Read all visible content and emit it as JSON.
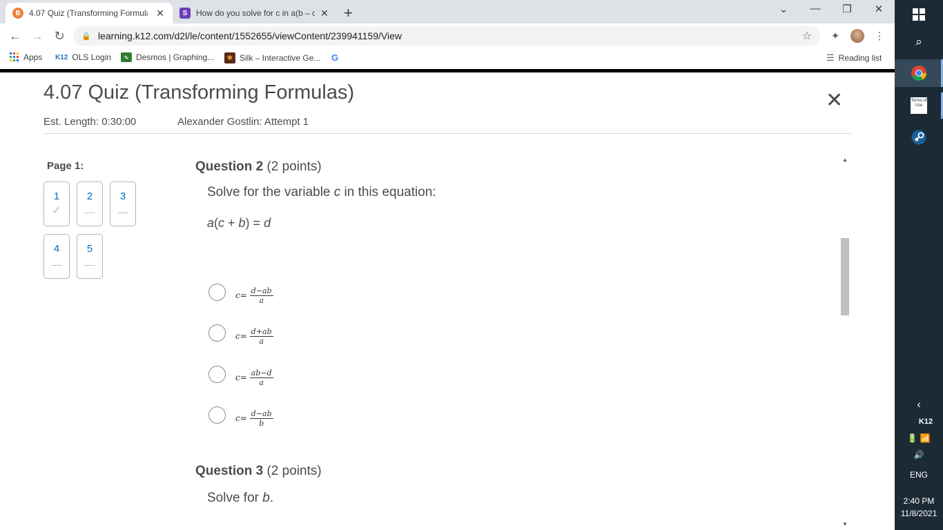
{
  "browser": {
    "tabs": [
      {
        "title": "4.07 Quiz (Transforming Formula",
        "favicon": "k12-icon",
        "close": "✕"
      },
      {
        "title": "How do you solve for c in a(b – c",
        "favicon": "silk-s-icon",
        "close": "✕"
      }
    ],
    "new_tab": "+",
    "url": "learning.k12.com/d2l/le/content/1552655/viewContent/239941159/View",
    "bookmarks": [
      {
        "label": "Apps",
        "icon": "apps-grid-icon"
      },
      {
        "label": "OLS Login",
        "icon": "k12-logo-icon",
        "icon_text": "K12"
      },
      {
        "label": "Desmos | Graphing...",
        "icon": "desmos-icon"
      },
      {
        "label": "Silk – Interactive Ge...",
        "icon": "silk-icon"
      },
      {
        "label": "",
        "icon": "google-g-icon",
        "icon_text": "G"
      }
    ],
    "reading_list": "Reading list"
  },
  "quiz": {
    "title": "4.07 Quiz (Transforming Formulas)",
    "est_length": "Est. Length: 0:30:00",
    "attempt": "Alexander Gostlin: Attempt 1",
    "page_label": "Page 1:",
    "question_nav": [
      {
        "number": "1",
        "status": "✓"
      },
      {
        "number": "2",
        "status": "––"
      },
      {
        "number": "3",
        "status": "––"
      },
      {
        "number": "4",
        "status": "––"
      },
      {
        "number": "5",
        "status": "––"
      }
    ]
  },
  "question2": {
    "label": "Question 2",
    "points": "(2 points)",
    "prompt_before": "Solve for the variable ",
    "prompt_var": "c",
    "prompt_after": " in this equation:",
    "equation": {
      "a": "a",
      "open": "(",
      "c": "c",
      "plus": " + ",
      "b": "b",
      "close": ")",
      "eq": " = ",
      "d": "d"
    },
    "options": [
      {
        "lhs": "c",
        "eq": " = ",
        "num": "d−ab",
        "den": "a"
      },
      {
        "lhs": "c",
        "eq": " = ",
        "num": "d+ab",
        "den": "a"
      },
      {
        "lhs": "c",
        "eq": " = ",
        "num": "ab−d",
        "den": "a"
      },
      {
        "lhs": "c",
        "eq": " = ",
        "num": "d−ab",
        "den": "b"
      }
    ]
  },
  "question3": {
    "label": "Question 3",
    "points": "(2 points)",
    "prompt_before": "Solve for ",
    "prompt_var": "b",
    "prompt_after": "."
  },
  "taskbar": {
    "terms_icon_text": "Terms of Use",
    "k12_label": "K12",
    "language": "ENG",
    "time": "2:40 PM",
    "date": "11/8/2021"
  },
  "colors": {
    "accent_link": "#006fbf",
    "text": "#494c4e",
    "taskbar": "#1c2a36"
  }
}
